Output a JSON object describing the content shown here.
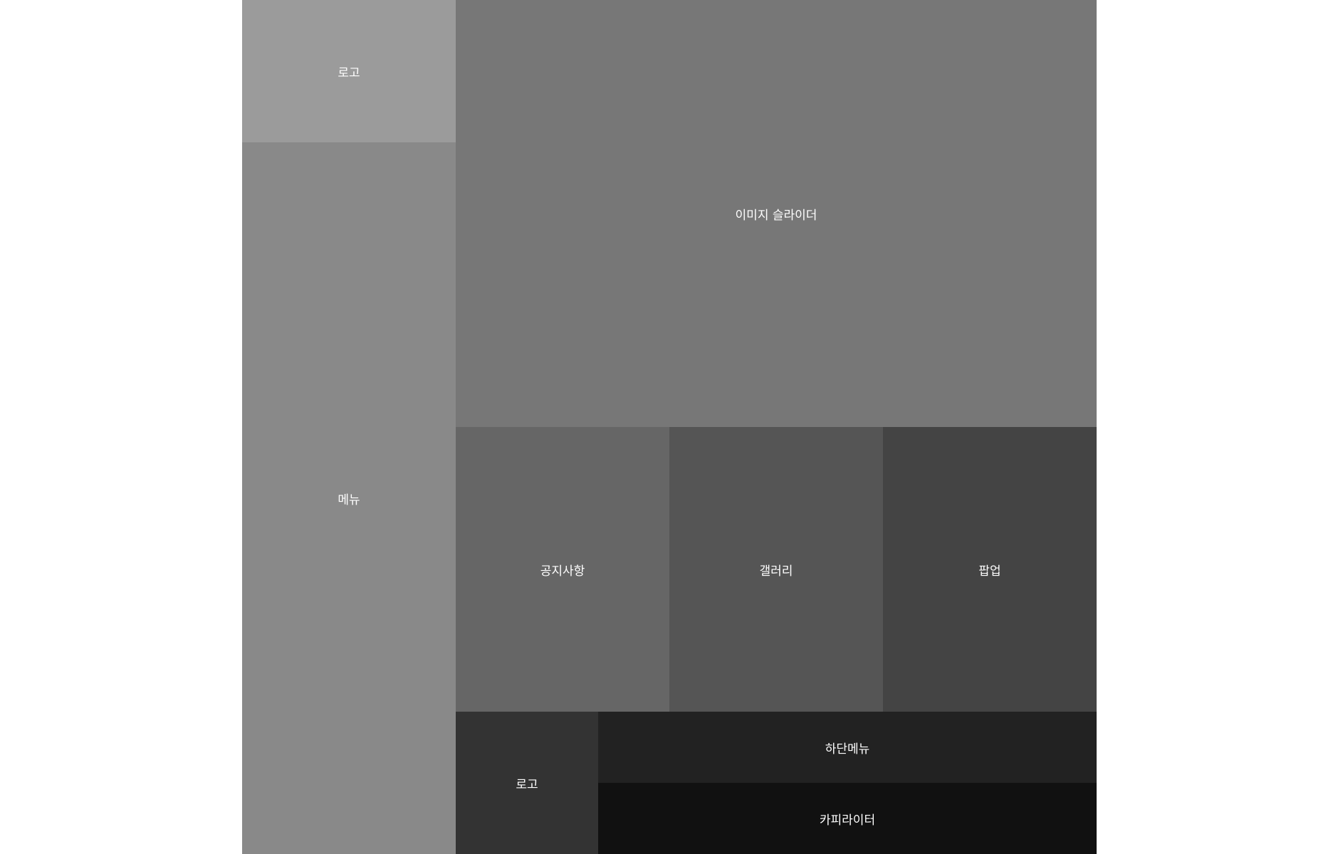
{
  "header": {
    "logo_label": "로고",
    "menu_label": "메뉴"
  },
  "main": {
    "slider_label": "이미지 슬라이더",
    "notice_label": "공지사항",
    "gallery_label": "갤러리",
    "popup_label": "팝업"
  },
  "footer": {
    "logo_label": "로고",
    "menu_label": "하단메뉴",
    "copyright_label": "카피라이터"
  },
  "colors": {
    "logo": "#9b9b9b",
    "menu": "#898989",
    "slider": "#777777",
    "notice": "#666666",
    "gallery": "#555555",
    "popup": "#444444",
    "footer_logo": "#333333",
    "footer_menu": "#222222",
    "copyright": "#111111"
  }
}
